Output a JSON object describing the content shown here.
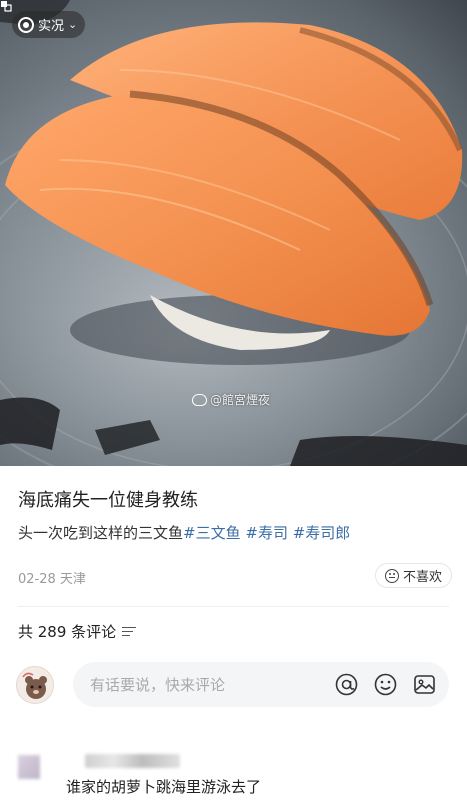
{
  "photo": {
    "live_badge_label": "实况",
    "watermark_text": "@館宮煙夜"
  },
  "post": {
    "title": "海底痛失一位健身教练",
    "body_prefix": "头一次吃到这样的三文鱼",
    "tags": [
      "#三文鱼",
      "#寿司",
      "#寿司郎"
    ],
    "date": "02-28",
    "location": "天津",
    "dislike_label": "不喜欢"
  },
  "comments": {
    "count_label": "共 289 条评论",
    "input_placeholder": "有话要说，快来评论",
    "input_icons": [
      "at-icon",
      "emoji-icon",
      "image-icon"
    ],
    "items": [
      {
        "text": "谁家的胡萝卜跳海里游泳去了"
      }
    ]
  },
  "colors": {
    "tag_color": "#3b6ea8",
    "salmon": "#f08a4b",
    "plate": "#7d868e"
  }
}
